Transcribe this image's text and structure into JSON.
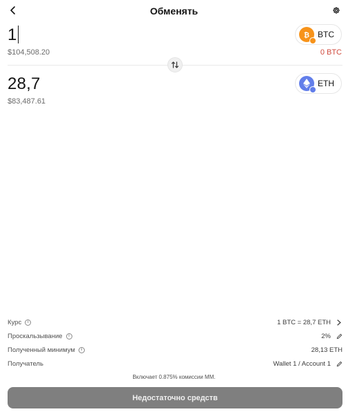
{
  "header": {
    "title": "Обменять",
    "back_icon": "chevron-left-icon",
    "settings_icon": "gear-icon"
  },
  "from": {
    "amount": "1",
    "fiat": "$104,508.20",
    "token": "BTC",
    "balance": "0 BTC",
    "token_color": "#f7931a",
    "balance_color": "#d04a3d"
  },
  "to": {
    "amount": "28,7",
    "fiat": "$83,487.61",
    "token": "ETH",
    "token_color": "#627eea"
  },
  "swap_icon": "swap-vertical-icon",
  "details": {
    "rate": {
      "label": "Курс",
      "value": "1 BTC = 28,7 ETH"
    },
    "slippage": {
      "label": "Проскальзывание",
      "value": "2%"
    },
    "min_received": {
      "label": "Полученный минимум",
      "value": "28,13 ETH"
    },
    "recipient": {
      "label": "Получатель",
      "value": "Wallet 1 / Account 1"
    }
  },
  "fee_note": "Включает 0.875% комиссии MM.",
  "cta": {
    "label": "Недостаточно средств",
    "color": "#7f7f7f"
  }
}
